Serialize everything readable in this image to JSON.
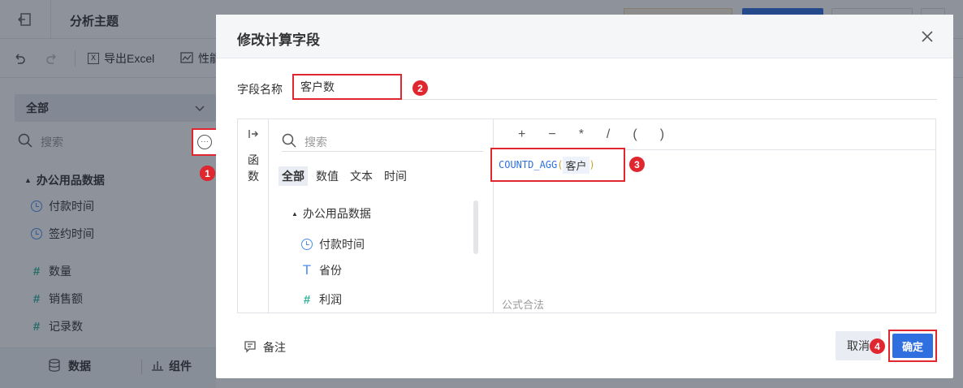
{
  "app": {
    "title": "分析主题",
    "toolbar": {
      "export_label": "导出Excel",
      "perf_label": "性能"
    },
    "scope_select": "全部",
    "search_placeholder": "搜索",
    "group_name": "办公用品数据",
    "fields": [
      {
        "name": "付款时间",
        "type": "date"
      },
      {
        "name": "签约时间",
        "type": "date"
      },
      {
        "name": "数量",
        "type": "number"
      },
      {
        "name": "销售额",
        "type": "number"
      },
      {
        "name": "记录数",
        "type": "number"
      }
    ],
    "bottom_tabs": {
      "data": "数据",
      "component": "组件"
    }
  },
  "modal": {
    "title": "修改计算字段",
    "field_name_label": "字段名称",
    "field_name_value": "客户数",
    "func_sidebar_label": "函数",
    "search_placeholder": "搜索",
    "filter_tabs": [
      "全部",
      "数值",
      "文本",
      "时间"
    ],
    "tree_group": "办公用品数据",
    "tree_items": [
      {
        "name": "付款时间",
        "type": "date"
      },
      {
        "name": "省份",
        "type": "text"
      },
      {
        "name": "利润",
        "type": "number"
      }
    ],
    "operators": [
      "+",
      "−",
      "*",
      "/",
      "(",
      ")"
    ],
    "formula": {
      "func": "COUNTD_AGG",
      "open": "(",
      "arg": "客户",
      "close": ")"
    },
    "status": "公式合法",
    "remark_label": "备注",
    "cancel_label": "取消",
    "confirm_label": "确定"
  },
  "annotations": [
    "1",
    "2",
    "3",
    "4"
  ],
  "colors": {
    "accent": "#2f6fe0",
    "highlight": "#e0262f",
    "number_icon": "#2fb39a"
  }
}
